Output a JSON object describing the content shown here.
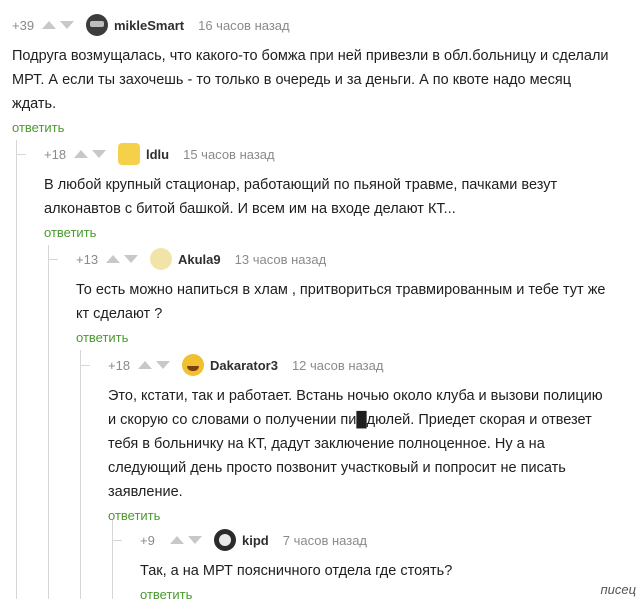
{
  "comments": [
    {
      "rating": "+39",
      "user": "mikleSmart",
      "time": "16 часов назад",
      "lines": [
        "Подруга возмущалась, что какого-то бомжа при ней привезли в обл.больницу и сделали",
        "МРТ. А если ты захочешь - то только в очередь и за деньги. А по квоте надо месяц",
        "ждать."
      ],
      "reply": "ответить"
    },
    {
      "rating": "+18",
      "user": "ldlu",
      "time": "15 часов назад",
      "lines": [
        "В любой крупный стационар, работающий по пьяной травме, пачками везут",
        "алконавтов с битой башкой. И всем им на входе делают КТ..."
      ],
      "reply": "ответить"
    },
    {
      "rating": "+13",
      "user": "Akula9",
      "time": "13 часов назад",
      "lines": [
        "То есть можно напиться в хлам , притвориться травмированным и тебе тут же",
        "кт сделают ?"
      ],
      "reply": "ответить"
    },
    {
      "rating": "+18",
      "user": "Dakarator3",
      "time": "12 часов назад",
      "lines": [
        "Это, кстати, так и работает. Встань ночью около клуба и вызови полицию",
        "и скорую со словами о получении пи█дюлей. Приедет скорая и отвезет",
        "тебя в больничку на КТ, дадут заключение полноценное. Ну а на",
        "следующий день просто позвонит участковый и попросит не писать",
        "заявление."
      ],
      "reply": "ответить"
    },
    {
      "rating": "+9",
      "user": "kipd",
      "time": "7 часов назад",
      "lines": [
        "Так, а на МРТ поясничного отдела где стоять?"
      ],
      "reply": "ответить"
    }
  ],
  "watermark": "писец",
  "colors": {
    "reply_link": "#4a9a2f",
    "meta_text": "#8a8a8a",
    "arrow": "#c8c8c8"
  },
  "icons": {
    "upvote": "upvote-arrow-icon",
    "downvote": "downvote-arrow-icon"
  }
}
